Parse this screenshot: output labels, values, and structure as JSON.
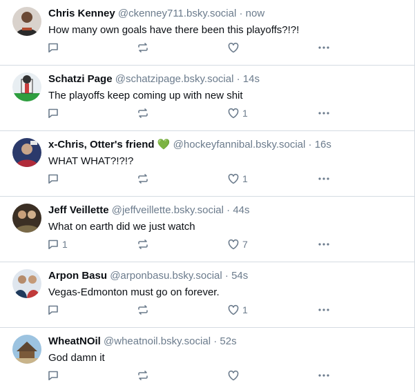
{
  "posts": [
    {
      "name": "Chris Kenney",
      "handle": "@ckenney711.bsky.social",
      "sep": " · ",
      "time": "now",
      "text": "How many own goals have there been this playoffs?!?!",
      "emoji": "",
      "replies": "",
      "reposts": "",
      "likes": "",
      "avatar_colors": [
        "#2a2a2a",
        "#b14a2e"
      ]
    },
    {
      "name": "Schatzi Page",
      "handle": "@schatzipage.bsky.social",
      "sep": " · ",
      "time": "14s",
      "text": "The playoffs keep coming up with new shit",
      "emoji": "",
      "replies": "",
      "reposts": "",
      "likes": "1",
      "avatar_colors": [
        "#2e9e3f",
        "#c83c3c"
      ]
    },
    {
      "name": "x-Chris, Otter's friend",
      "handle": "@hockeyfannibal.bsky.social",
      "sep": " · ",
      "time": "16s",
      "text": "WHAT WHAT?!?!?",
      "emoji": "💚",
      "replies": "",
      "reposts": "",
      "likes": "1",
      "avatar_colors": [
        "#2b3a6b",
        "#b02b3a"
      ]
    },
    {
      "name": "Jeff Veillette",
      "handle": "@jeffveillette.bsky.social",
      "sep": " · ",
      "time": "44s",
      "text": "What on earth did we just watch",
      "emoji": "",
      "replies": "1",
      "reposts": "",
      "likes": "7",
      "avatar_colors": [
        "#3b2f24",
        "#7a6a48"
      ]
    },
    {
      "name": "Arpon Basu",
      "handle": "@arponbasu.bsky.social",
      "sep": " · ",
      "time": "54s",
      "text": "Vegas-Edmonton must go on forever.",
      "emoji": "",
      "replies": "",
      "reposts": "",
      "likes": "1",
      "avatar_colors": [
        "#1f3a5c",
        "#c03a3a"
      ]
    },
    {
      "name": "WheatNOil",
      "handle": "@wheatnoil.bsky.social",
      "sep": " · ",
      "time": "52s",
      "text": "God damn it",
      "emoji": "",
      "replies": "",
      "reposts": "",
      "likes": "",
      "avatar_colors": [
        "#6fa0c8",
        "#7a5a3a"
      ]
    }
  ],
  "icons": {
    "reply": "speech-bubble-icon",
    "repost": "repost-arrows-icon",
    "like": "heart-icon",
    "more": "ellipsis-icon"
  },
  "colors": {
    "text": "#0b0f14",
    "muted": "#6b7b8c",
    "border": "#d4dbe2"
  }
}
